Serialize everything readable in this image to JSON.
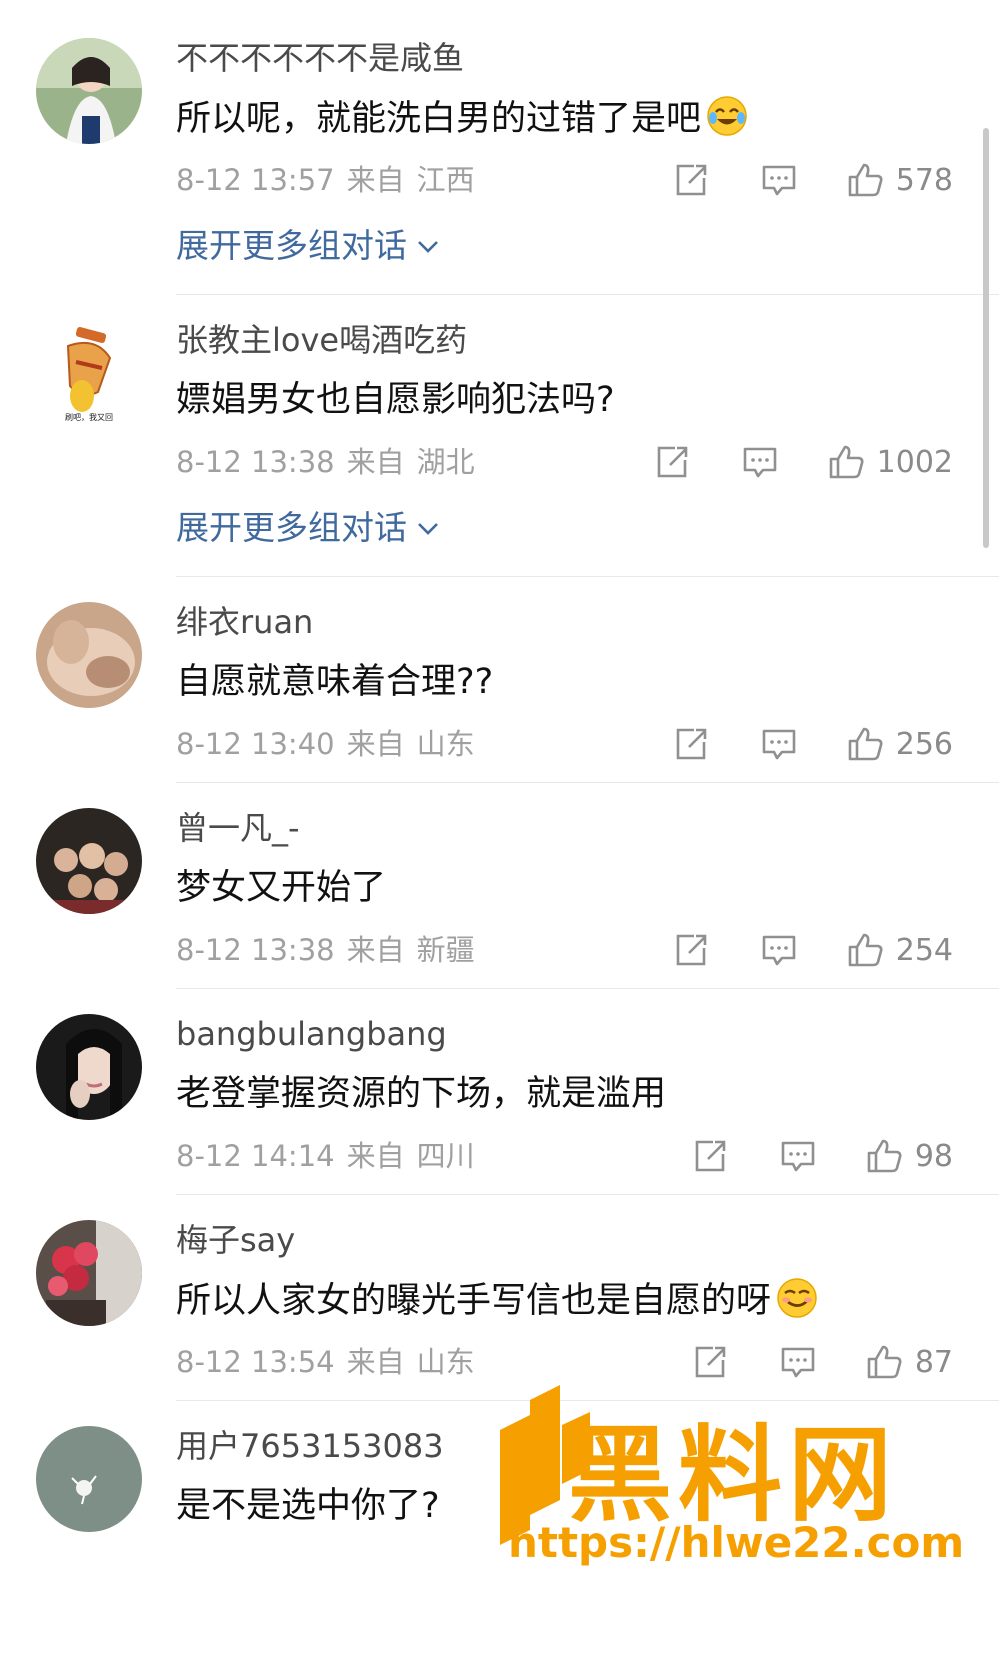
{
  "comments": [
    {
      "user": "不不不不不不是咸鱼",
      "text": "所以呢，就能洗白男的过错了是吧",
      "emoji": "crying-laughing-emoji",
      "date": "8-12 13:57",
      "from": "来自",
      "location": "江西",
      "likes": "578",
      "expand": "展开更多组对话"
    },
    {
      "user": "张教主love喝酒吃药",
      "text": "嫖娼男女也自愿影响犯法吗?",
      "date": "8-12 13:38",
      "from": "来自",
      "location": "湖北",
      "likes": "1002",
      "expand": "展开更多组对话",
      "avatar_caption": "刷吧，我又回"
    },
    {
      "user": "绯衣ruan",
      "text": "自愿就意味着合理??",
      "date": "8-12 13:40",
      "from": "来自",
      "location": "山东",
      "likes": "256"
    },
    {
      "user": "曾一凡_-",
      "text": "梦女又开始了",
      "date": "8-12 13:38",
      "from": "来自",
      "location": "新疆",
      "likes": "254"
    },
    {
      "user": "bangbulangbang",
      "text": "老登掌握资源的下场，就是滥用",
      "date": "8-12 14:14",
      "from": "来自",
      "location": "四川",
      "likes": "98"
    },
    {
      "user": "梅子say",
      "text": "所以人家女的曝光手写信也是自愿的呀",
      "emoji": "smirk-emoji",
      "date": "8-12 13:54",
      "from": "来自",
      "location": "山东",
      "likes": "87"
    },
    {
      "user": "用户7653153083",
      "text": "是不是选中你了?"
    }
  ],
  "watermark": {
    "name": "黑料网",
    "url": "https://hlwe22.com"
  },
  "colors": {
    "link": "#40699e",
    "meta": "#a0a0a0",
    "watermark": "#f5a000"
  }
}
